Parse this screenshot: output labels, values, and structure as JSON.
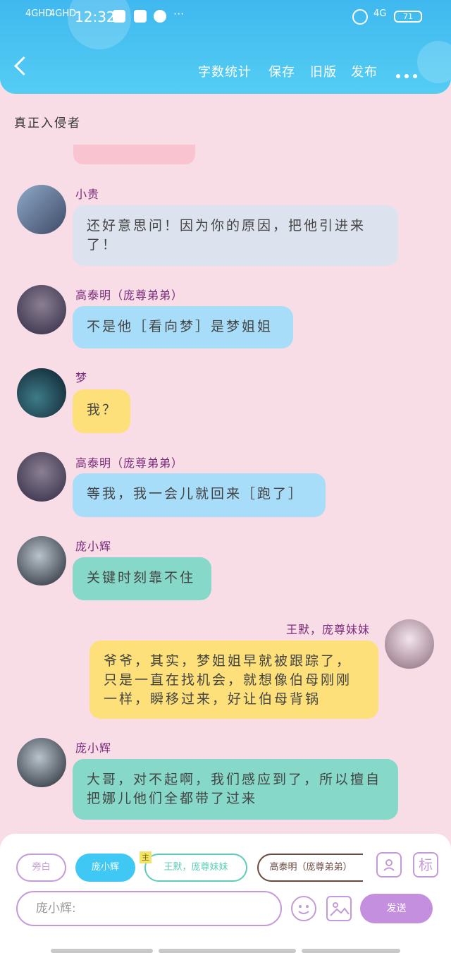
{
  "status": {
    "net1": "4GHD",
    "net2": "4GHD",
    "time": "12:32",
    "net3": "4G",
    "battery": "71",
    "dots": "···"
  },
  "toolbar": {
    "word_count": "字数统计",
    "save": "保存",
    "old_version": "旧版",
    "publish": "发布"
  },
  "chat": {
    "title": "真正入侵者",
    "messages": [
      {
        "name": "小贵",
        "text": "还好意思问！因为你的原因，把他引进来了！"
      },
      {
        "name": "高泰明（庞尊弟弟）",
        "text": "不是他［看向梦］是梦姐姐"
      },
      {
        "name": "梦",
        "text": "我？"
      },
      {
        "name": "高泰明（庞尊弟弟）",
        "text": "等我，我一会儿就回来［跑了］"
      },
      {
        "name": "庞小辉",
        "text": "关键时刻靠不住"
      },
      {
        "name": "王默，庞尊妹妹",
        "text": "爷爷，其实，梦姐姐早就被跟踪了，只是一直在找机会，就想像伯母刚刚一样，瞬移过来，好让伯母背锅"
      },
      {
        "name": "庞小辉",
        "text": "大哥，对不起啊，我们感应到了，所以擅自把娜儿他们全都带了过来"
      }
    ]
  },
  "composer": {
    "chips": [
      "旁白",
      "庞小辉",
      "王默，庞尊妹妹",
      "高泰明（庞尊弟弟）"
    ],
    "main_badge": "主",
    "tag_button": "标",
    "input_value": "庞小辉:",
    "send": "发送"
  }
}
